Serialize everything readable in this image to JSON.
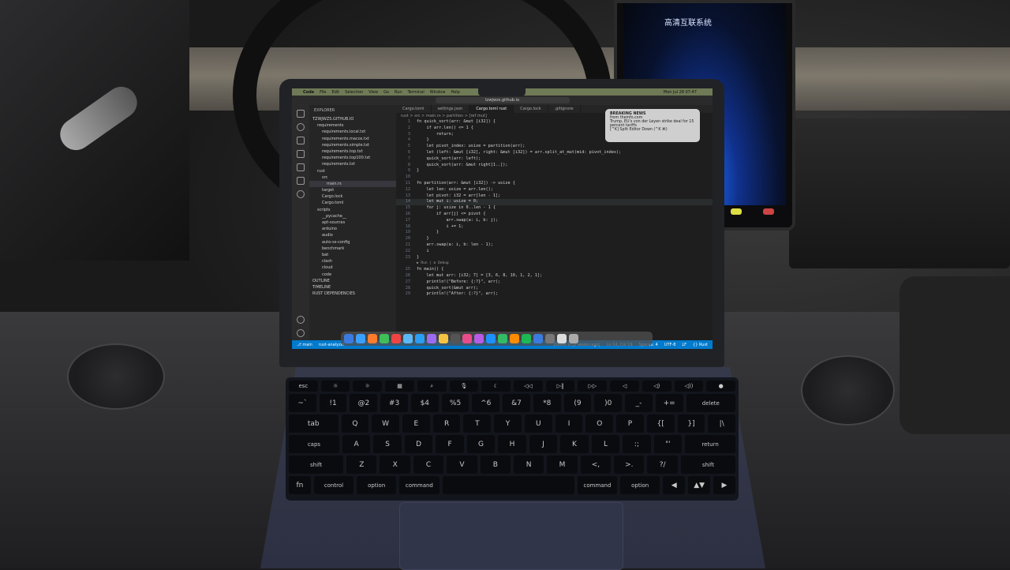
{
  "menubar": {
    "items": [
      "Code",
      "File",
      "Edit",
      "Selection",
      "View",
      "Go",
      "Run",
      "Terminal",
      "Window",
      "Help"
    ],
    "clock": "Mon Jul 28 07:47"
  },
  "titlebar": {
    "search": "tzwjwzs.github.io"
  },
  "sidebar": {
    "header": "EXPLORER",
    "items": [
      "TZWJWZS.GITHUB.IO",
      "requirements",
      "requirements.local.txt",
      "requirements.macos.txt",
      "requirements.simple.txt",
      "requirements.top.txt",
      "requirements.top100.txt",
      "requirements.txt",
      "rust",
      "src",
      "main.rs",
      "target",
      "Cargo.lock",
      "Cargo.toml",
      "scripts",
      "__pycache__",
      "apt-sources",
      "arduino",
      "audio",
      "auto-ss-config",
      "benchmark",
      "bat",
      "clash",
      "cloud",
      "code",
      "OUTLINE",
      "TIMELINE",
      "RUST DEPENDENCIES"
    ]
  },
  "tabs": [
    "Cargo.toml",
    "settings.json",
    "Cargo.toml  rust",
    "Cargo.lock",
    ".gitignore"
  ],
  "breadcrumbs": "rust > src > main.rs > partition > [ref mut]",
  "code": [
    {
      "n": "1",
      "t": "fn quick_sort(arr: &mut [i32]) {"
    },
    {
      "n": "2",
      "t": "    if arr.len() <= 1 {"
    },
    {
      "n": "3",
      "t": "        return;"
    },
    {
      "n": "4",
      "t": "    }"
    },
    {
      "n": "5",
      "t": "    let pivot_index: usize = partition(arr);"
    },
    {
      "n": "6",
      "t": "    let (left: &mut [i32], right: &mut [i32]) = arr.split_at_mut(mid: pivot_index);"
    },
    {
      "n": "7",
      "t": "    quick_sort(arr: left);"
    },
    {
      "n": "8",
      "t": "    quick_sort(arr: &mut right[1..]);"
    },
    {
      "n": "9",
      "t": "}"
    },
    {
      "n": "10",
      "t": ""
    },
    {
      "n": "11",
      "t": "fn partition(arr: &mut [i32]) -> usize {"
    },
    {
      "n": "12",
      "t": "    let len: usize = arr.len();"
    },
    {
      "n": "13",
      "t": "    let pivot: i32 = arr[len - 1];"
    },
    {
      "n": "14",
      "t": "    let mut i: usize = 0;"
    },
    {
      "n": "15",
      "t": "    for j: usize in 0..len - 1 {"
    },
    {
      "n": "16",
      "t": "        if arr[j] <= pivot {"
    },
    {
      "n": "17",
      "t": "            arr.swap(a: i, b: j);"
    },
    {
      "n": "18",
      "t": "            i += 1;"
    },
    {
      "n": "19",
      "t": "        }"
    },
    {
      "n": "20",
      "t": "    }"
    },
    {
      "n": "21",
      "t": "    arr.swap(a: i, b: len - 1);"
    },
    {
      "n": "22",
      "t": "    i"
    },
    {
      "n": "23",
      "t": "}"
    },
    {
      "n": "",
      "t": "▶ Run | ⚙ Debug"
    },
    {
      "n": "25",
      "t": "fn main() {"
    },
    {
      "n": "26",
      "t": "    let mut arr: [i32; 7] = [3, 6, 8, 10, 1, 2, 1];"
    },
    {
      "n": "27",
      "t": "    println!(\"Before: {:?}\", arr);"
    },
    {
      "n": "28",
      "t": "    quick_sort(&mut arr);"
    },
    {
      "n": "29",
      "t": "    println!(\"After: {:?}\", arr);"
    }
  ],
  "current_line": "14",
  "statusbar": {
    "left": [
      "⎇ main",
      "rust-analyzer"
    ],
    "right": [
      "Zhiwei Li (2 weeks ago)",
      "Ln 14, Col 19",
      "Spaces: 4",
      "UTF-8",
      "LF",
      "{} Rust"
    ]
  },
  "notification": {
    "title": "BREAKING NEWS",
    "source": "from theinfo.com",
    "body": "Trump, EU's von der Leyen strike deal for 15 percent tariffs",
    "footer": "[^K] Split Editor Down (^K ⌘)"
  },
  "dock": {
    "icon_colors": [
      "#3b7be0",
      "#3aa0ff",
      "#ff7b2e",
      "#3fbf5a",
      "#e44",
      "#5bb8f5",
      "#2a9df4",
      "#9d6bf2",
      "#f5c542",
      "#555",
      "#e84c8b",
      "#b85be6",
      "#1e90ff",
      "#33bb66",
      "#ff8c00",
      "#1db954",
      "#3b7be0",
      "#777",
      "#ddd",
      "#aaa"
    ]
  },
  "car_screen": {
    "text": "高清互联系统"
  },
  "keyboard": {
    "rows": [
      [
        "esc",
        "☼",
        "☼",
        "▦",
        "⌕",
        "🎙",
        "☾",
        "◁◁",
        "▷‖",
        "▷▷",
        "◁",
        "◁)",
        "◁))",
        "●"
      ],
      [
        "~`",
        "!1",
        "@2",
        "#3",
        "$4",
        "%5",
        "^6",
        "&7",
        "*8",
        "(9",
        ")0",
        "_-",
        "+=",
        "delete"
      ],
      [
        "tab",
        "Q",
        "W",
        "E",
        "R",
        "T",
        "Y",
        "U",
        "I",
        "O",
        "P",
        "{[",
        "}]",
        "|\\"
      ],
      [
        "caps",
        "A",
        "S",
        "D",
        "F",
        "G",
        "H",
        "J",
        "K",
        "L",
        ":;",
        "\"'",
        "return"
      ],
      [
        "shift",
        "Z",
        "X",
        "C",
        "V",
        "B",
        "N",
        "M",
        "<,",
        ">.",
        "?/",
        "shift"
      ],
      [
        "fn",
        "control",
        "option",
        "command",
        "",
        "command",
        "option",
        "◀",
        "▲▼",
        "▶"
      ]
    ]
  }
}
